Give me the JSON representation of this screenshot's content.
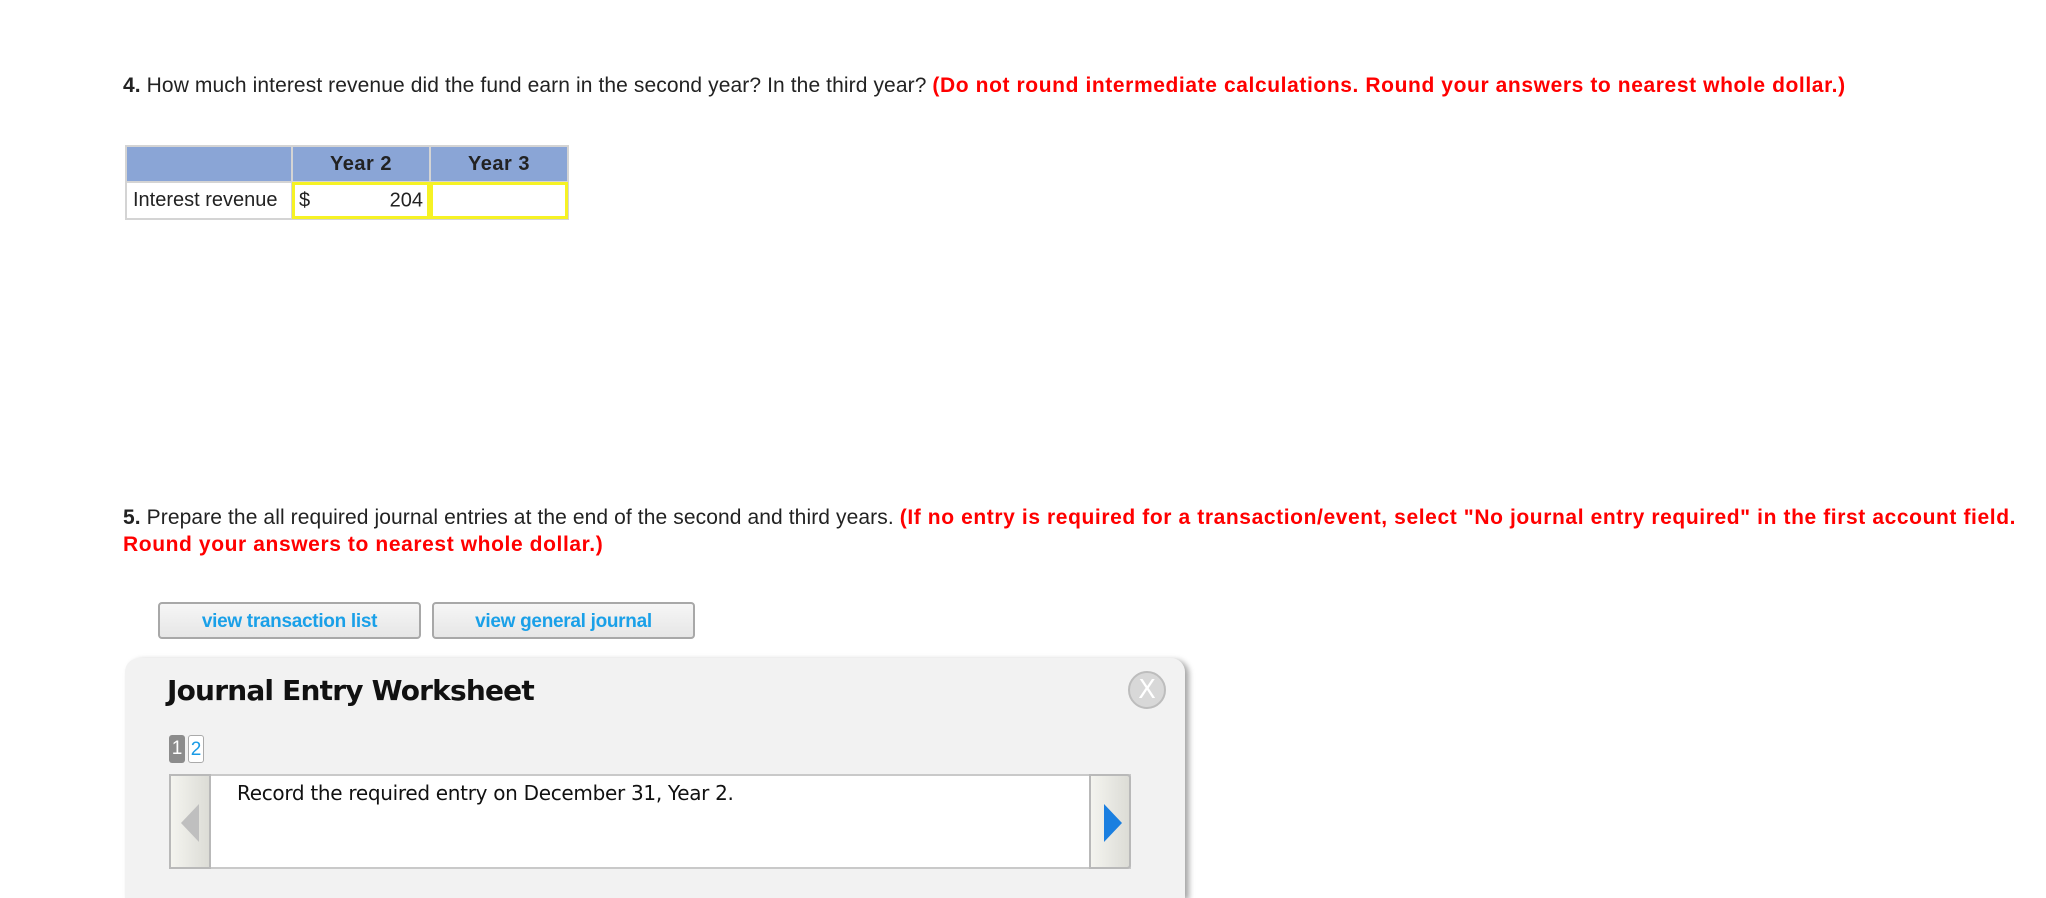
{
  "question4": {
    "number": "4.",
    "text": " How much interest revenue did the fund earn in the second year? In the third year? ",
    "instruction": "(Do not round intermediate calculations. Round your answers to nearest whole dollar.)"
  },
  "answer_table": {
    "headers": [
      "",
      "Year 2",
      "Year 3"
    ],
    "rows": [
      {
        "label": "Interest revenue",
        "year2": {
          "currency": "$",
          "value": "204"
        },
        "year3": {
          "currency": "",
          "value": ""
        }
      }
    ]
  },
  "question5": {
    "number": "5.",
    "text": " Prepare the all required journal entries at the end of the second and third years. ",
    "instruction": "(If no entry is required for a transaction/event, select \"No journal entry required\" in the first account field. Round your answers to nearest whole dollar.)"
  },
  "buttons": {
    "transaction_list": "view transaction list",
    "general_journal": "view general journal"
  },
  "worksheet": {
    "title": "Journal Entry Worksheet",
    "close_label": "X",
    "pages": [
      "1",
      "2"
    ],
    "active_page": 1,
    "entry_instruction": "Record the required entry on December 31, Year 2.",
    "colors": {
      "accent_blue": "#1a9be6",
      "next_arrow": "#1a7fe0",
      "instruction_red": "#ff0000",
      "header_blue": "#8aa5d6",
      "input_highlight": "#f6f224"
    }
  }
}
